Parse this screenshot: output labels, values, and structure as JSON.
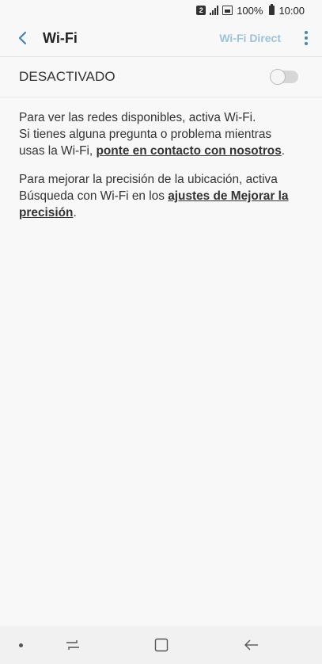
{
  "status_bar": {
    "sim": "2",
    "battery": "100%",
    "time": "10:00"
  },
  "app_bar": {
    "title": "Wi-Fi",
    "wifi_direct": "Wi-Fi Direct"
  },
  "master_switch": {
    "label": "DESACTIVADO",
    "state": "off"
  },
  "info": {
    "p1_line1": "Para ver las redes disponibles, activa Wi-Fi.",
    "p1_text": "Si tienes alguna pregunta o problema mientras usas la Wi-Fi, ",
    "p1_link": "ponte en contacto con nosotros",
    "p1_end": ".",
    "p2_text": "Para mejorar la precisión de la ubicación, activa Búsqueda con Wi-Fi en los ",
    "p2_link": "ajustes de Mejorar la precisión",
    "p2_end": "."
  },
  "colors": {
    "accent": "#3d87b8",
    "wifi_direct_disabled": "#9cc3dc",
    "background": "#f8f8f8"
  }
}
